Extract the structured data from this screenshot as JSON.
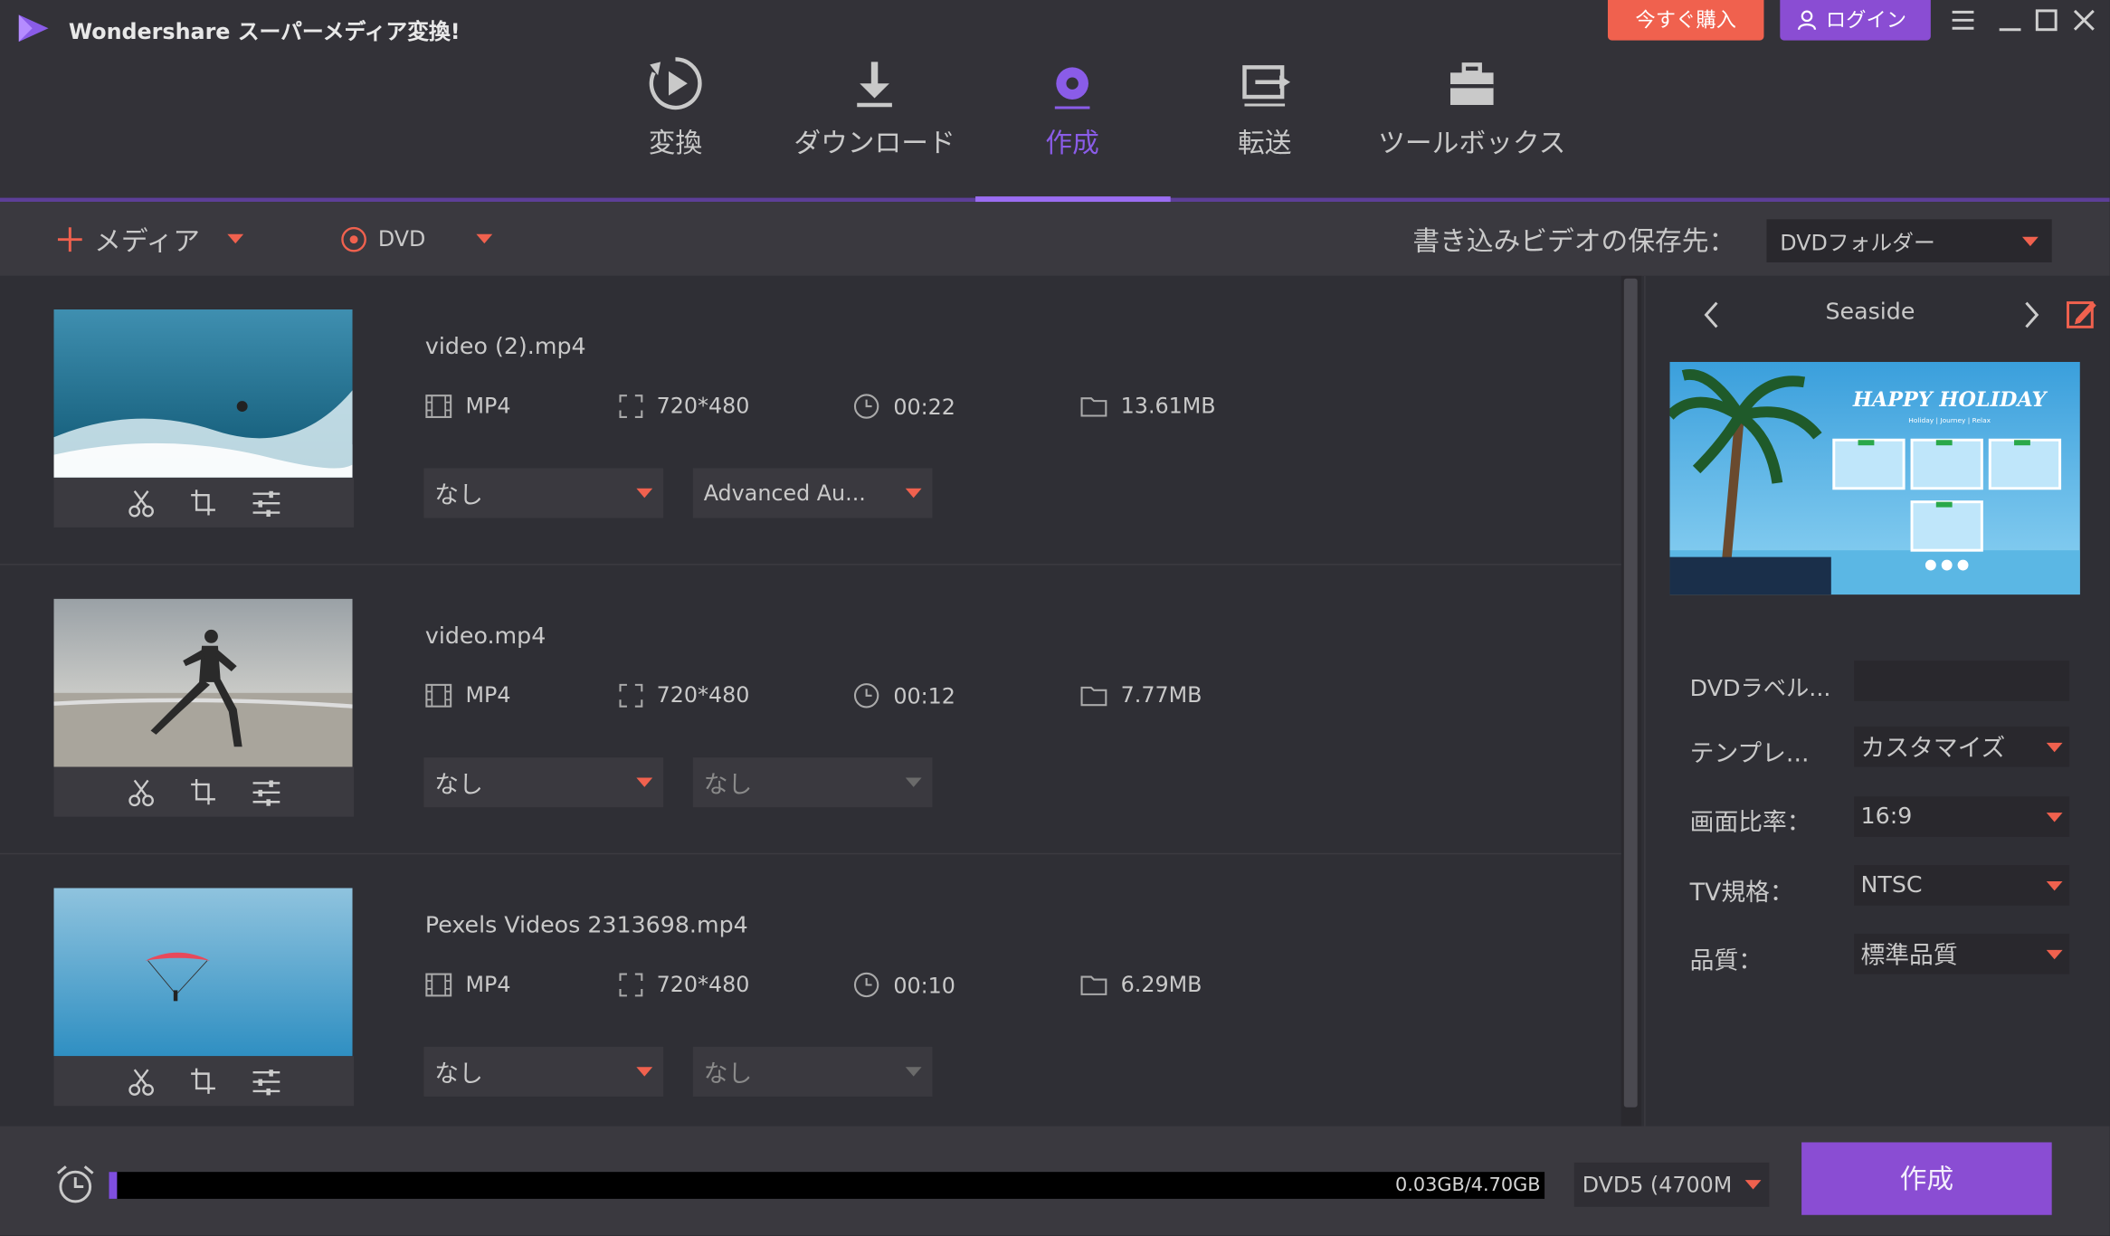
{
  "app": {
    "title": "Wondershare スーパーメディア変換!",
    "buy_label": "今すぐ購入",
    "login_label": "ログイン"
  },
  "nav": {
    "tabs": [
      {
        "label": "変換",
        "icon": "convert-icon"
      },
      {
        "label": "ダウンロード",
        "icon": "download-icon"
      },
      {
        "label": "作成",
        "icon": "disc-burn-icon",
        "active": true
      },
      {
        "label": "転送",
        "icon": "transfer-icon"
      },
      {
        "label": "ツールボックス",
        "icon": "toolbox-icon"
      }
    ]
  },
  "toolbar": {
    "add_media_label": "メディア",
    "disc_type_label": "DVD",
    "save_to_label": "書き込みビデオの保存先：",
    "save_to_value": "DVDフォルダー"
  },
  "videos": [
    {
      "name": "video (2).mp4",
      "format": "MP4",
      "resolution": "720*480",
      "duration": "00:22",
      "size": "13.61MB",
      "subtitle": "なし",
      "audio": "Advanced Au..."
    },
    {
      "name": "video.mp4",
      "format": "MP4",
      "resolution": "720*480",
      "duration": "00:12",
      "size": "7.77MB",
      "subtitle": "なし",
      "audio": "なし"
    },
    {
      "name": "Pexels Videos 2313698.mp4",
      "format": "MP4",
      "resolution": "720*480",
      "duration": "00:10",
      "size": "6.29MB",
      "subtitle": "なし",
      "audio": "なし"
    }
  ],
  "template": {
    "name": "Seaside",
    "preview_title": "HAPPY HOLIDAY",
    "preview_subtitle": "Holiday | Journey | Relax"
  },
  "settings": {
    "dvd_label": {
      "label": "DVDラベル...",
      "value": ""
    },
    "template": {
      "label": "テンプレ...",
      "value": "カスタマイズ"
    },
    "aspect": {
      "label": "画面比率：",
      "value": "16:9"
    },
    "tv_standard": {
      "label": "TV規格：",
      "value": "NTSC"
    },
    "quality": {
      "label": "品質：",
      "value": "標準品質"
    }
  },
  "bottom": {
    "usage_text": "0.03GB/4.70GB",
    "usage_fraction": 0.006,
    "disc_size": "DVD5 (4700M",
    "create_label": "作成"
  },
  "colors": {
    "accent": "#8a4dd3",
    "buy": "#f0614e",
    "caret": "#f0614e"
  }
}
